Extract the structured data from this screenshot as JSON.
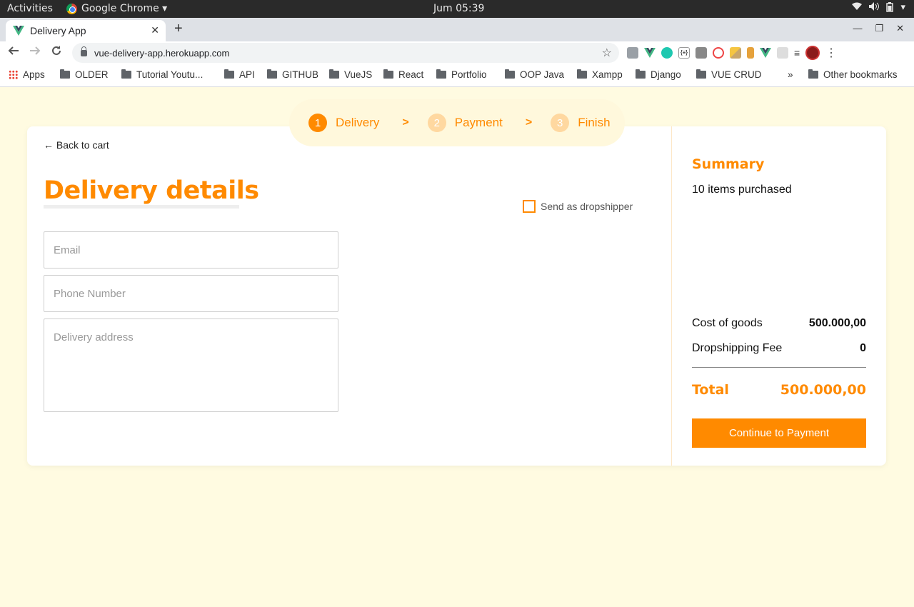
{
  "gnome": {
    "activities": "Activities",
    "app": "Google Chrome ▾",
    "clock": "Jum 05:39"
  },
  "tab": {
    "title": "Delivery App",
    "close": "✕",
    "new": "+"
  },
  "window_controls": [
    "—",
    "❐",
    "✕"
  ],
  "omnibox": {
    "url": "vue-delivery-app.herokuapp.com"
  },
  "bookmarks": {
    "apps": "Apps",
    "folders": [
      "OLDER",
      "Tutorial Youtu...",
      "API",
      "GITHUB",
      "VueJS",
      "React",
      "Portfolio",
      "OOP Java",
      "Xampp",
      "Django",
      "VUE CRUD"
    ],
    "more": "»",
    "other": "Other bookmarks"
  },
  "stepper": {
    "steps": [
      {
        "num": "1",
        "label": "Delivery"
      },
      {
        "num": "2",
        "label": "Payment"
      },
      {
        "num": "3",
        "label": "Finish"
      }
    ],
    "separator": ">"
  },
  "form": {
    "back": "← Back to cart",
    "title": "Delivery details",
    "dropship_label": "Send as dropshipper",
    "email_placeholder": "Email",
    "phone_placeholder": "Phone Number",
    "address_placeholder": "Delivery address"
  },
  "summary": {
    "title": "Summary",
    "items": "10 items purchased",
    "cost_label": "Cost of goods",
    "cost_value": "500.000,00",
    "fee_label": "Dropshipping Fee",
    "fee_value": "0",
    "total_label": "Total",
    "total_value": "500.000,00",
    "button": "Continue to Payment"
  },
  "colors": {
    "accent": "#ff8a00",
    "page_bg": "#fffbe1"
  }
}
